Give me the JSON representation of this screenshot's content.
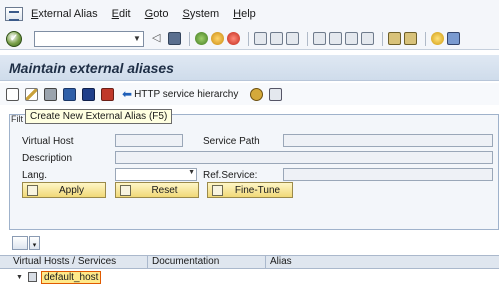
{
  "menu": {
    "items": [
      "External Alias",
      "Edit",
      "Goto",
      "System",
      "Help"
    ]
  },
  "title": "Maintain external aliases",
  "app_toolbar": {
    "http_button_label": "HTTP service hierarchy"
  },
  "tooltip": "Create New External Alias   (F5)",
  "frame_tab_label": "Filt",
  "form": {
    "virtual_host_label": "Virtual Host",
    "service_path_label": "Service Path",
    "description_label": "Description",
    "lang_label": "Lang.",
    "ref_service_label": "Ref.Service:"
  },
  "buttons": {
    "apply": "Apply",
    "reset": "Reset",
    "fine_tune": "Fine-Tune"
  },
  "tree": {
    "columns": [
      "Virtual Hosts / Services",
      "Documentation",
      "Alias"
    ],
    "rows": [
      {
        "label": "default_host",
        "expanded": true
      }
    ]
  },
  "colors": {
    "title_bg": "#cfdceb",
    "button_bg": "#f1d978",
    "selection_border": "#e05a00",
    "selection_fill": "#ffe98a"
  }
}
